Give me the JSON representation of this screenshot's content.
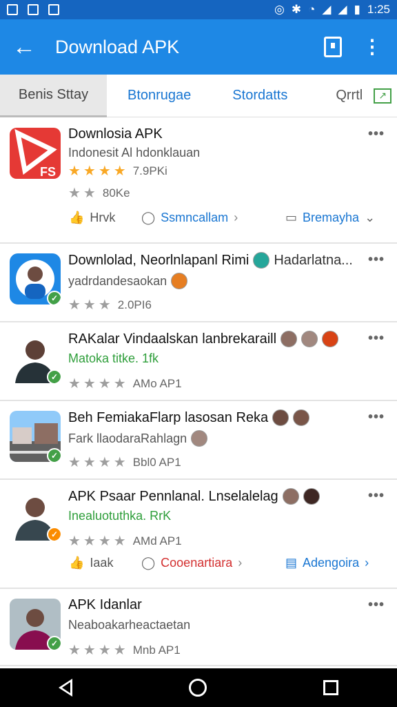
{
  "status_bar": {
    "time": "1:25"
  },
  "app_bar": {
    "title": "Download APK"
  },
  "tabs": [
    {
      "label": "Benis Sttay",
      "active": true
    },
    {
      "label": "Btonrugae",
      "active": false
    },
    {
      "label": "Stordatts",
      "active": false
    },
    {
      "label": "Qrrtl",
      "active": false
    }
  ],
  "items": [
    {
      "title": "Downlosia APK",
      "subtitle": "Indonesit Al hdonklauan",
      "rating_line1": "7.9PKi",
      "rating_line2": "80Ke",
      "actions": {
        "like": "Hrvk",
        "comment": "Ssmncallam",
        "share": "Bremayha"
      }
    },
    {
      "title": "Downlolad, Neorlnlapanl Rimi",
      "title_extra": "Hadarlatna...",
      "subtitle": "yadrdandesaokan",
      "rating": "2.0PI6"
    },
    {
      "title": "RAKalar Vindaalskan lanbrekaraill",
      "subtitle": "Matoka titke. 1fk",
      "rating": "AMo AP1"
    },
    {
      "title": "Beh FemiakaFlarp lasosan Reka",
      "subtitle": "Fark llaodaraRahlagn",
      "rating": "Bbl0 AP1"
    },
    {
      "title": "APK Psaar Pennlanal. Lnselalelag",
      "subtitle": "Inealuotuthka. RrK",
      "rating": "AMd AP1",
      "actions": {
        "like": "Iaak",
        "comment": "Cooenartiara",
        "share": "Adengoira"
      }
    },
    {
      "title": "APK Idanlar",
      "subtitle": "Neaboakarheactaetan",
      "rating": "Mnb AP1"
    }
  ],
  "colors": {
    "primary": "#1e88e5",
    "status": "#1565c0",
    "link": "#1976d2",
    "green": "#2e9e3a",
    "red_link": "#d32f2f"
  }
}
